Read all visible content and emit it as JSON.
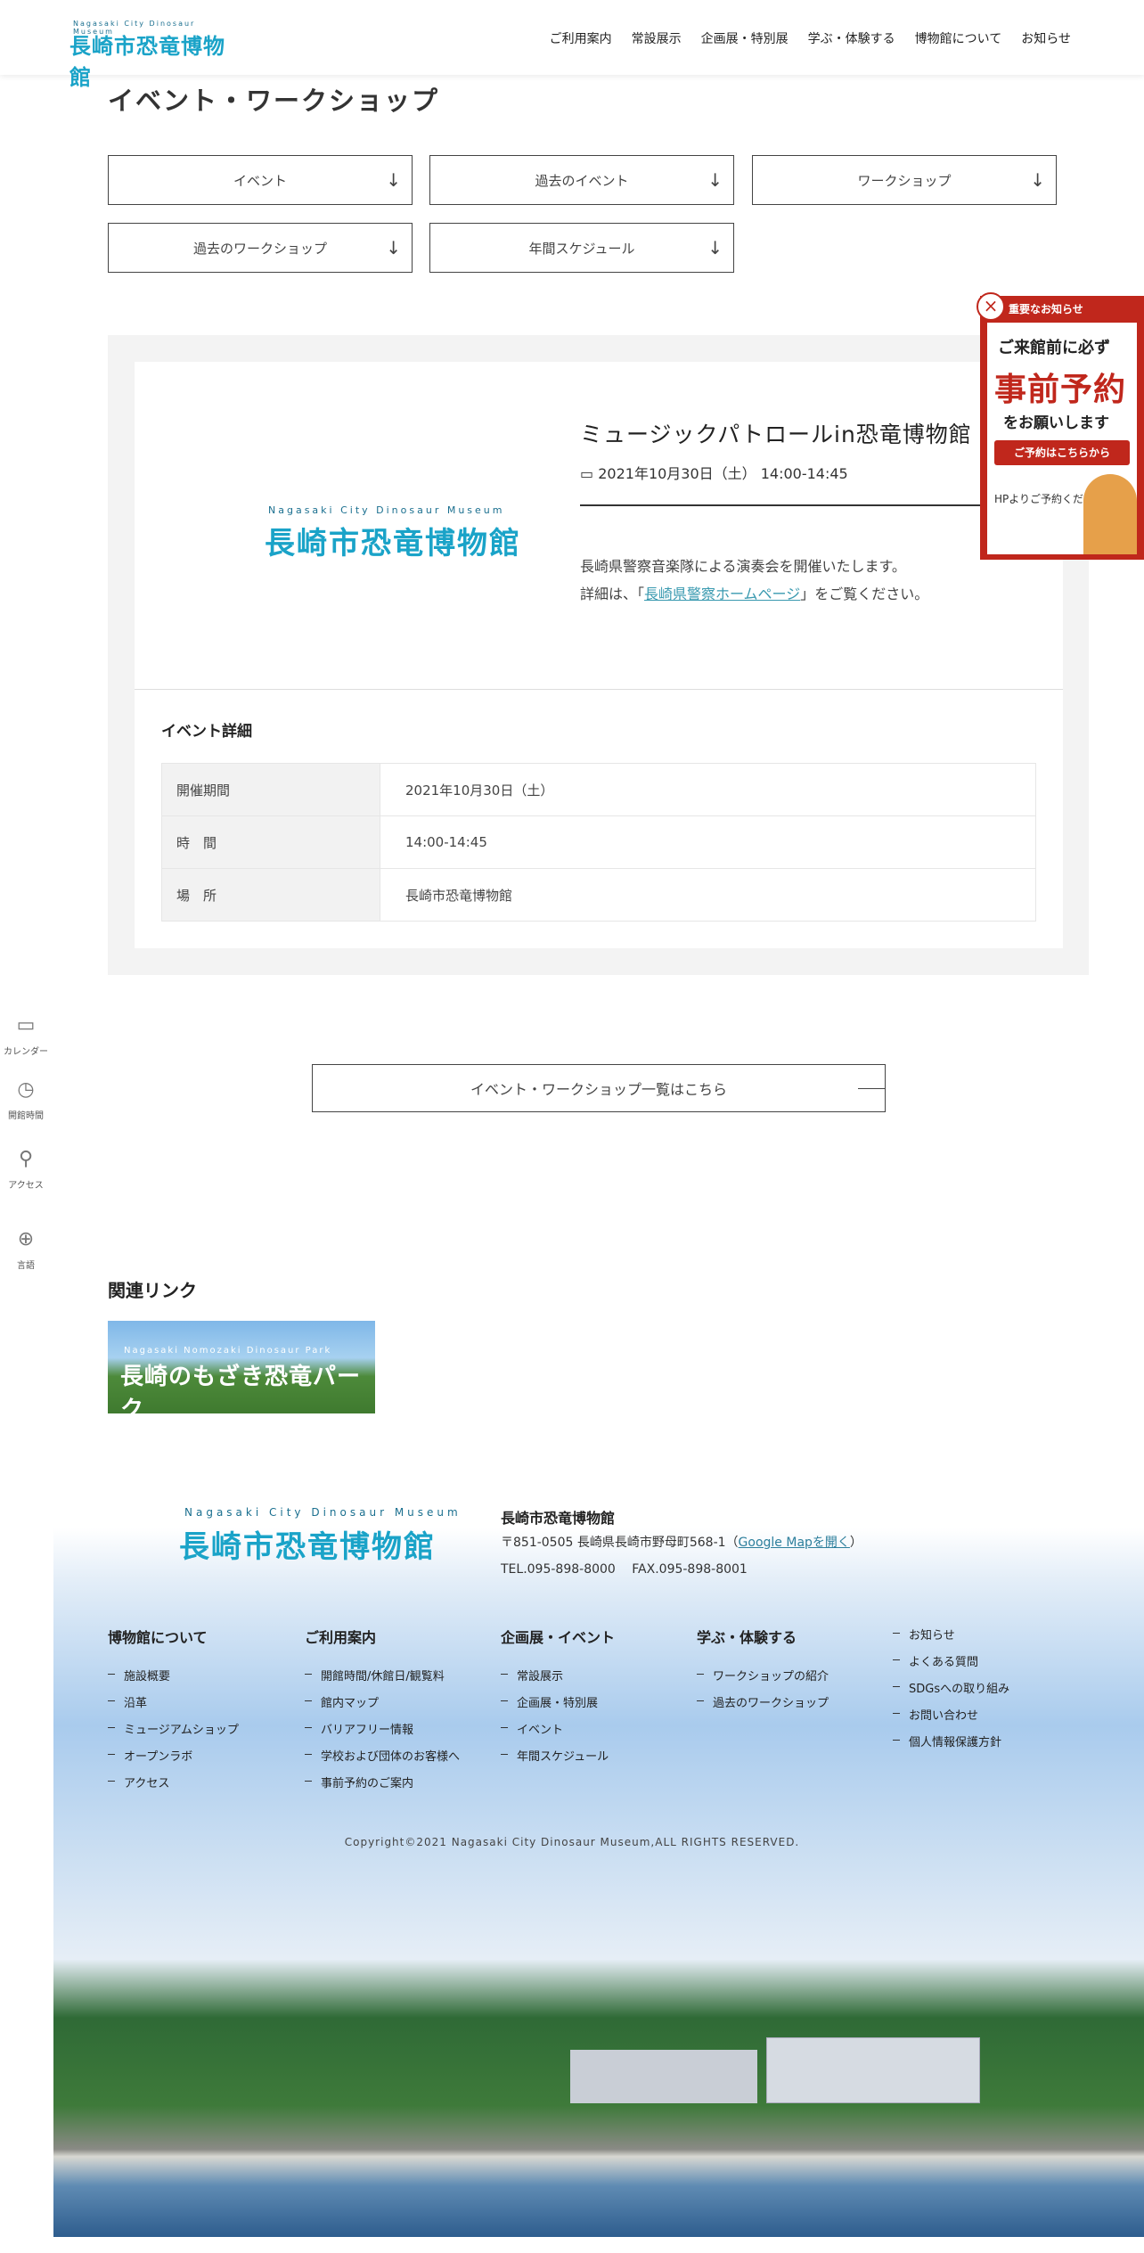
{
  "header": {
    "logo_sub": "Nagasaki City Dinosaur Museum",
    "logo_main": "長崎市恐竜博物館",
    "nav": [
      "ご利用案内",
      "常設展示",
      "企画展・特別展",
      "学ぶ・体験する",
      "博物館について",
      "お知らせ"
    ]
  },
  "page_title": "イベント・ワークショップ",
  "filters": [
    "イベント",
    "過去のイベント",
    "ワークショップ",
    "過去のワークショップ",
    "年間スケジュール"
  ],
  "event": {
    "title": "ミュージックパトロールin恐竜博物館",
    "date": "2021年10月30日（土） 14:00-14:45",
    "desc_line1": "長崎県警察音楽隊による演奏会を開催いたします。",
    "desc_line2_pre": "詳細は、「",
    "desc_link": "長崎県警察ホームページ",
    "desc_line2_post": "」をご覧ください。",
    "detail_heading": "イベント詳細",
    "details": [
      {
        "key": "開催期間",
        "value": "2021年10月30日（土）"
      },
      {
        "key": "時　間",
        "value": "14:00-14:45"
      },
      {
        "key": "場　所",
        "value": "長崎市恐竜博物館"
      }
    ]
  },
  "side_nav": [
    {
      "label": "カレンダー",
      "icon": "calendar-icon"
    },
    {
      "label": "開館時間",
      "icon": "clock-icon"
    },
    {
      "label": "アクセス",
      "icon": "pin-icon"
    },
    {
      "label": "言語",
      "icon": "globe-icon"
    }
  ],
  "list_button": "イベント・ワークショップ一覧はこちら",
  "related": {
    "heading": "関連リンク",
    "banner_sub": "Nagasaki Nomozaki Dinosaur Park",
    "banner_main": "長崎のもざき恐竜パーク"
  },
  "popup": {
    "header": "重要なお知らせ",
    "line1": "ご来館前に必ず",
    "line2": "事前予約",
    "line3": "をお願いします",
    "button": "ご予約はこちらから",
    "line4": "HPよりご予約ください。"
  },
  "footer": {
    "name": "長崎市恐竜博物館",
    "address": "〒851-0505 長崎県長崎市野母町568-1（",
    "map_link": "Google Mapを開く",
    "address_end": "）",
    "tel": "TEL.095-898-8000　 FAX.095-898-8001",
    "columns": [
      {
        "heading": "博物館について",
        "items": [
          "施設概要",
          "沿革",
          "ミュージアムショップ",
          "オープンラボ",
          "アクセス"
        ]
      },
      {
        "heading": "ご利用案内",
        "items": [
          "開館時間/休館日/観覧料",
          "館内マップ",
          "バリアフリー情報",
          "学校および団体のお客様へ",
          "事前予約のご案内"
        ]
      },
      {
        "heading": "企画展・イベント",
        "items": [
          "常設展示",
          "企画展・特別展",
          "イベント",
          "年間スケジュール"
        ]
      },
      {
        "heading": "学ぶ・体験する",
        "items": [
          "ワークショップの紹介",
          "過去のワークショップ"
        ]
      },
      {
        "heading": "",
        "items": [
          "お知らせ",
          "よくある質問",
          "SDGsへの取り組み",
          "お問い合わせ",
          "個人情報保護方針"
        ]
      }
    ],
    "copyright": "Copyright©2021 Nagasaki City Dinosaur Museum,ALL RIGHTS RESERVED."
  }
}
